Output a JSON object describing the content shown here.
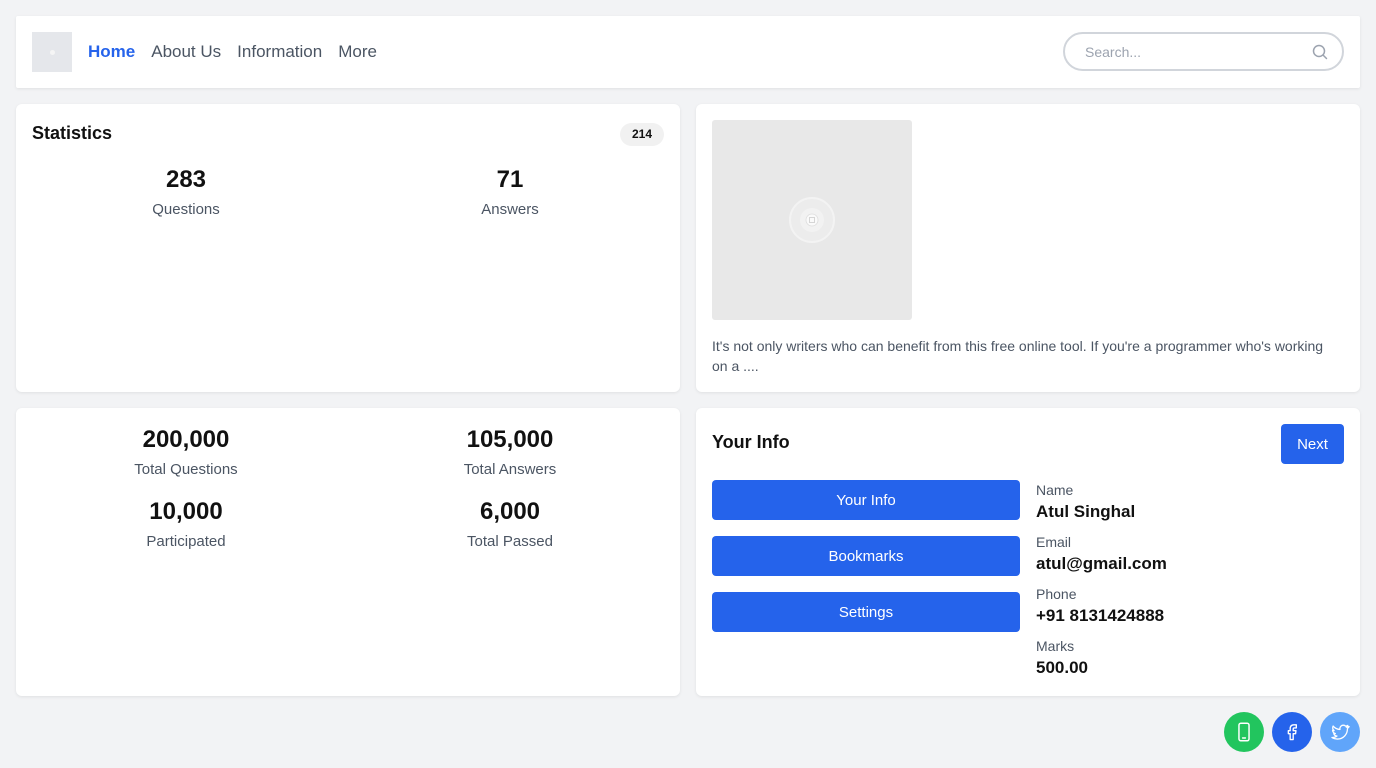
{
  "nav": {
    "links": [
      {
        "label": "Home",
        "active": true
      },
      {
        "label": "About Us",
        "active": false
      },
      {
        "label": "Information",
        "active": false
      },
      {
        "label": "More",
        "active": false
      }
    ],
    "search_placeholder": "Search..."
  },
  "statistics": {
    "title": "Statistics",
    "badge": "214",
    "items": [
      {
        "value": "283",
        "label": "Questions"
      },
      {
        "value": "71",
        "label": "Answers"
      }
    ]
  },
  "article": {
    "image_icon": "image-placeholder-icon",
    "text": "It's not only writers who can benefit from this free online tool. If you're a programmer who's working on a ...."
  },
  "totals": {
    "items": [
      {
        "value": "200,000",
        "label": "Total Questions"
      },
      {
        "value": "105,000",
        "label": "Total Answers"
      },
      {
        "value": "10,000",
        "label": "Participated"
      },
      {
        "value": "6,000",
        "label": "Total Passed"
      }
    ]
  },
  "info": {
    "title": "Your Info",
    "next_label": "Next",
    "menu": [
      "Your Info",
      "Bookmarks",
      "Settings"
    ],
    "fields": [
      {
        "label": "Name",
        "value": "Atul Singhal"
      },
      {
        "label": "Email",
        "value": "atul@gmail.com"
      },
      {
        "label": "Phone",
        "value": "+91 8131424888"
      },
      {
        "label": "Marks",
        "value": "500.00"
      }
    ]
  },
  "social": [
    {
      "icon": "phone-icon",
      "color": "#22c55e"
    },
    {
      "icon": "facebook-icon",
      "color": "#2563eb"
    },
    {
      "icon": "twitter-icon",
      "color": "#60a5fa"
    }
  ],
  "colors": {
    "accent": "#2563eb",
    "background": "#f2f3f5"
  }
}
